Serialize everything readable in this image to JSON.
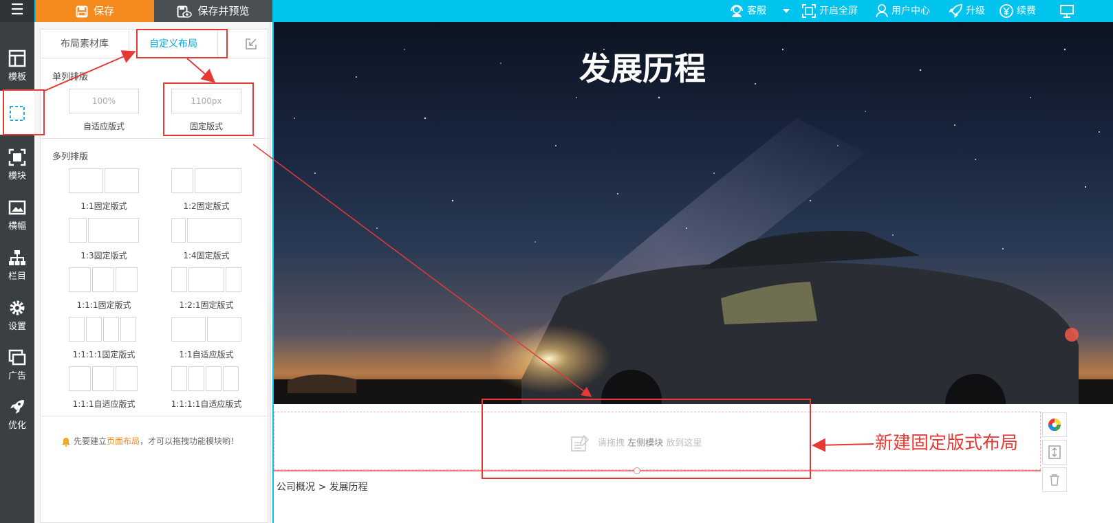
{
  "toolbar": {
    "menu_glyph": "☰",
    "save_label": "保存",
    "save_preview_label": "保存并预览",
    "service_label": "客服",
    "fullscreen_label": "开启全屏",
    "user_center_label": "用户中心",
    "upgrade_label": "升级",
    "renew_label": "续费"
  },
  "sidebar": {
    "items": [
      {
        "label": "模板",
        "icon": "template-icon"
      },
      {
        "label": "",
        "icon": "layout-icon"
      },
      {
        "label": "模块",
        "icon": "module-icon"
      },
      {
        "label": "横幅",
        "icon": "banner-icon"
      },
      {
        "label": "栏目",
        "icon": "column-icon"
      },
      {
        "label": "设置",
        "icon": "gear-icon"
      },
      {
        "label": "广告",
        "icon": "ad-icon"
      },
      {
        "label": "优化",
        "icon": "rocket-icon"
      }
    ]
  },
  "panel": {
    "tabs": [
      "布局素材库",
      "自定义布局"
    ],
    "single_title": "单列排版",
    "single": [
      {
        "box": "100%",
        "caption": "自适应版式"
      },
      {
        "box": "1100px",
        "caption": "固定版式"
      }
    ],
    "multi_title": "多列排版",
    "multi": [
      "1:1固定版式",
      "1:2固定版式",
      "1:3固定版式",
      "1:4固定版式",
      "1:1:1固定版式",
      "1:2:1固定版式",
      "1:1:1:1固定版式",
      "1:1自适应版式",
      "1:1:1自适应版式",
      "1:1:1:1自适应版式"
    ],
    "tip_prefix": "先要建立",
    "tip_link": "页面布局",
    "tip_suffix": "，才可以拖拽功能模块哟！"
  },
  "canvas": {
    "banner_title": "发展历程",
    "drop_hint_prefix": "请拖拽",
    "drop_hint_bold": "左侧模块",
    "drop_hint_suffix": "放到这里",
    "breadcrumb": "公司概况 > 发展历程"
  },
  "annotation": {
    "label": "新建固定版式布局"
  },
  "colors": {
    "topbar": "#00c3ee",
    "save": "#f58a1e",
    "sidebar": "#3a3f44",
    "annotation": "#e53935"
  }
}
